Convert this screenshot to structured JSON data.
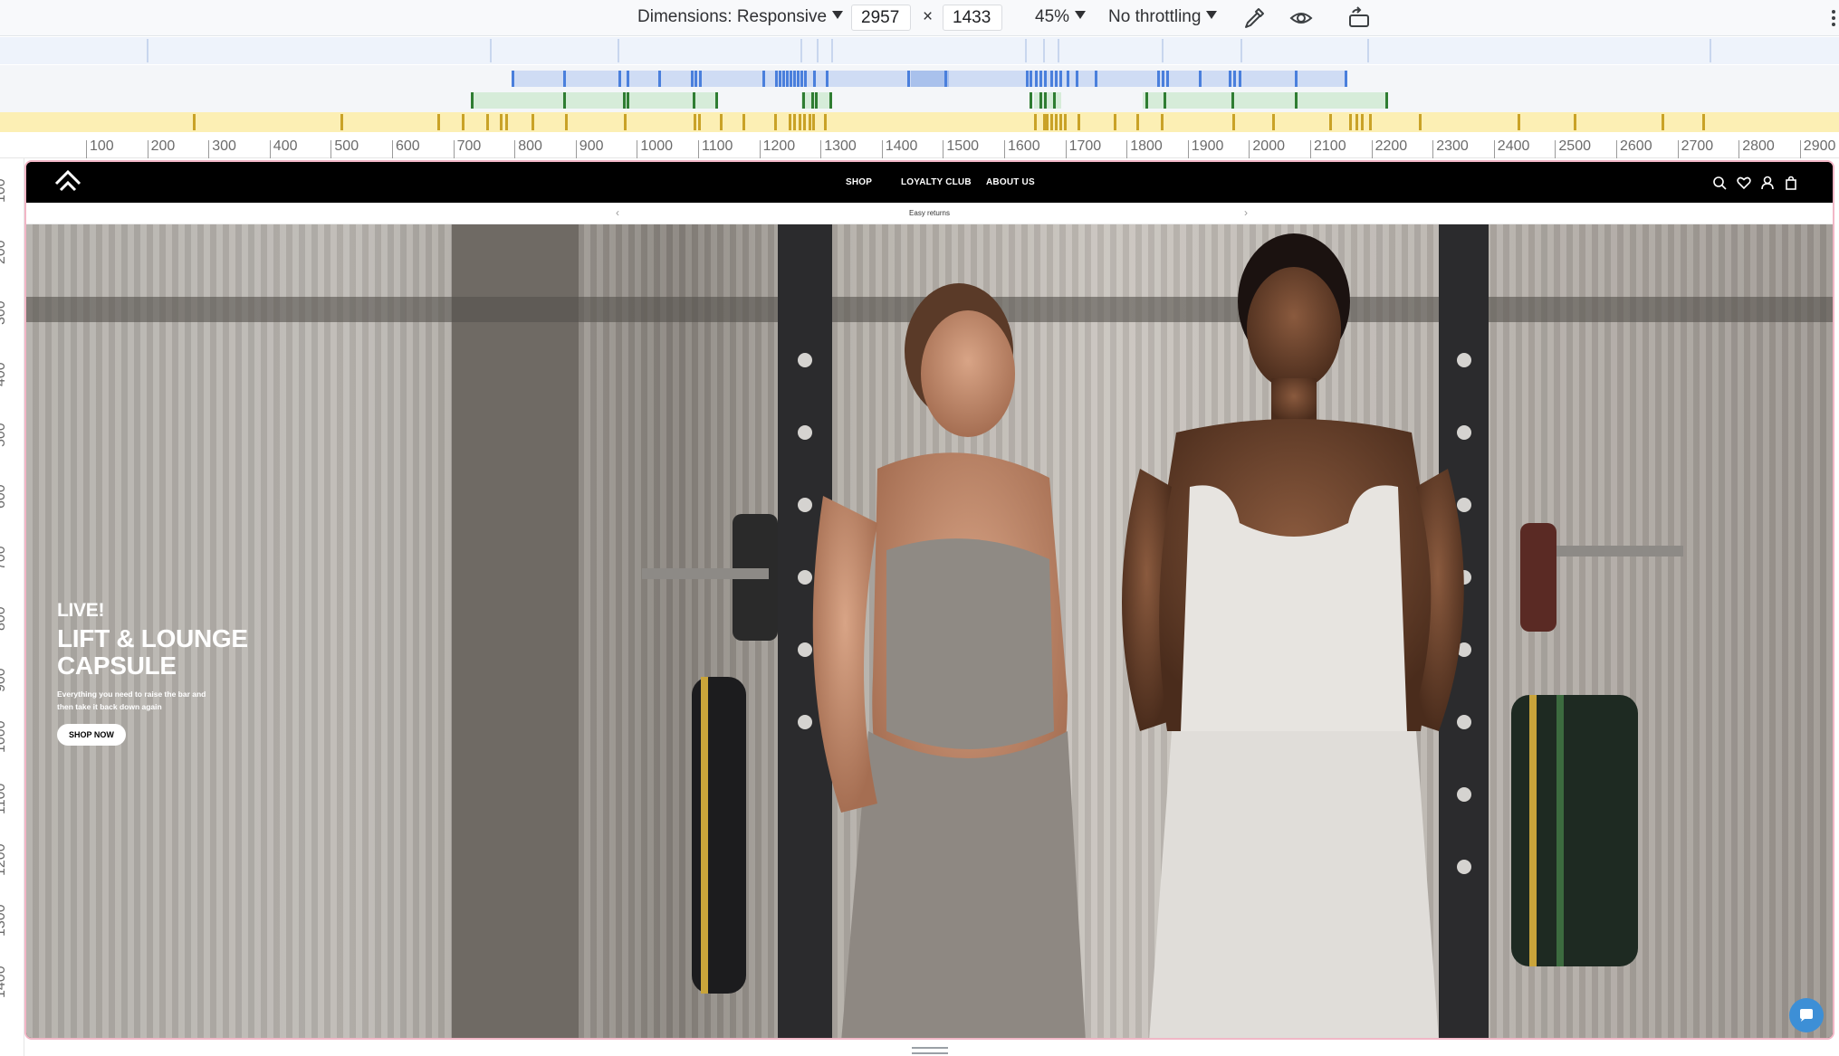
{
  "devtools": {
    "dimensions_label": "Dimensions: Responsive",
    "width_value": "2957",
    "times_sign": "×",
    "height_value": "1433",
    "zoom_label": "45%",
    "throttling_label": "No throttling",
    "icons": [
      "eyedropper-icon",
      "eye-icon",
      "rotate-icon",
      "more-vertical-icon"
    ],
    "ruler_top_labels": [
      "100",
      "200",
      "300",
      "400",
      "500",
      "600",
      "700",
      "800",
      "900",
      "1000",
      "1100",
      "1200",
      "1300",
      "1400",
      "1500",
      "1600",
      "1700",
      "1800",
      "1900",
      "2000",
      "2100",
      "2200",
      "2300",
      "2400",
      "2500",
      "2600",
      "2700",
      "2800",
      "2900"
    ],
    "ruler_left_labels": [
      "100",
      "200",
      "300",
      "400",
      "500",
      "600",
      "700",
      "800",
      "900",
      "1000",
      "1100",
      "1200",
      "1300",
      "1400"
    ],
    "colors": {
      "max_width": "#4a7fdc",
      "min_width": "#2f7d32",
      "range_bar": "#f4d03f",
      "viewport_outline": "#f2b6c6"
    }
  },
  "site": {
    "header": {
      "logo_name": "chevron-logo",
      "nav": [
        "SHOP",
        "LOYALTY CLUB",
        "ABOUT US"
      ],
      "icons": [
        "search-icon",
        "heart-icon",
        "account-icon",
        "bag-icon"
      ]
    },
    "announcement": {
      "text": "Easy returns",
      "prev": "‹",
      "next": "›"
    },
    "hero": {
      "eyebrow": "LIVE!",
      "title": "LIFT & LOUNGE CAPSULE",
      "subtitle": "Everything you need to raise the bar and then take it back down again",
      "cta": "SHOP NOW"
    },
    "chat_icon": "chat-bubble-icon"
  }
}
